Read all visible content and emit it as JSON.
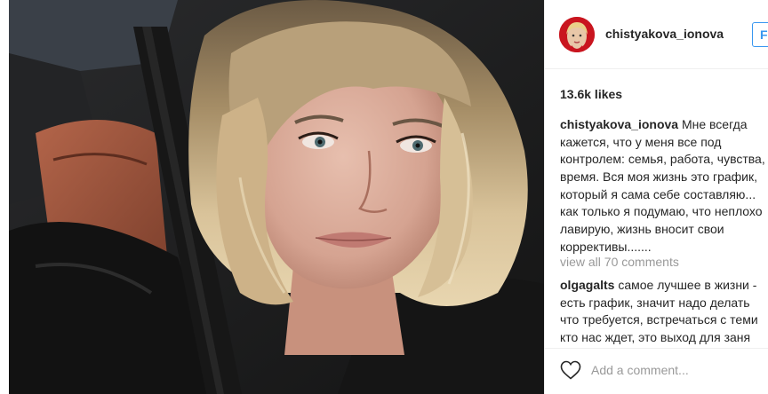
{
  "post": {
    "username": "chistyakova_ionova",
    "follow_label": "Follow",
    "likes": "13.6k likes"
  },
  "caption": {
    "author": "chistyakova_ionova",
    "lines": [
      "Мне всегда",
      "кажется, что у меня все под",
      "контролем: семья, работа, чувства,",
      "время. Вся моя жизнь это график,",
      "который я сама себе составляю...",
      "как только я подумаю, что неплохо",
      "лавирую, жизнь вносит свои",
      "коррективы......."
    ]
  },
  "view_all": "view all 70 comments",
  "comment": {
    "author": "olgagalts",
    "lines": [
      "самое лучшее в жизни -",
      "есть график, значит надо делать",
      "что требуется, встречаться с теми",
      "кто нас ждет, это выход для заня"
    ]
  },
  "add_comment": {
    "placeholder": "Add a comment..."
  },
  "colors": {
    "accent": "#3897f0",
    "muted_text": "#999999",
    "text": "#262626",
    "avatar_ring": "#c9151f"
  },
  "icons": {
    "like": "heart-outline-icon"
  }
}
